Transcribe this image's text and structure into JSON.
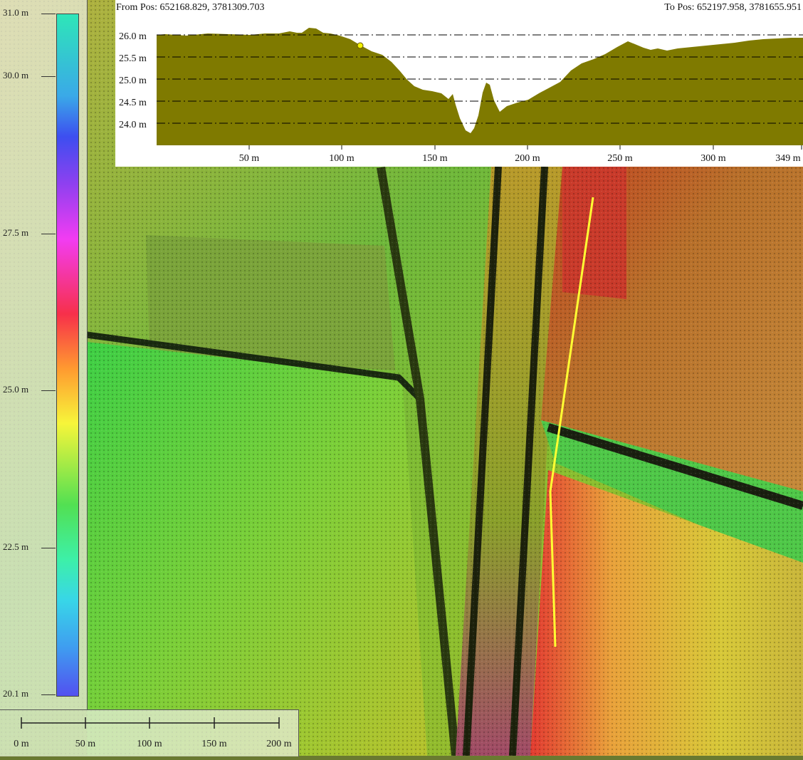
{
  "profile": {
    "from_label": "From Pos: 652168.829, 3781309.703",
    "to_label": "To Pos: 652197.958, 3781655.951",
    "y_ticks": [
      "26.0 m",
      "25.5 m",
      "25.0 m",
      "24.5 m",
      "24.0 m"
    ],
    "x_ticks": [
      "50 m",
      "100 m",
      "150 m",
      "200 m",
      "250 m",
      "300 m",
      "349 m"
    ],
    "fill_color": "#7f7a00",
    "marker_color": "#f2f200"
  },
  "legend": {
    "labels": [
      "31.0 m",
      "30.0 m",
      "27.5 m",
      "25.0 m",
      "22.5 m",
      "20.1 m"
    ]
  },
  "scalebar": {
    "labels": [
      "0 m",
      "50 m",
      "100 m",
      "150 m",
      "200 m"
    ]
  },
  "map": {
    "profile_line_color": "#ffff33"
  }
}
